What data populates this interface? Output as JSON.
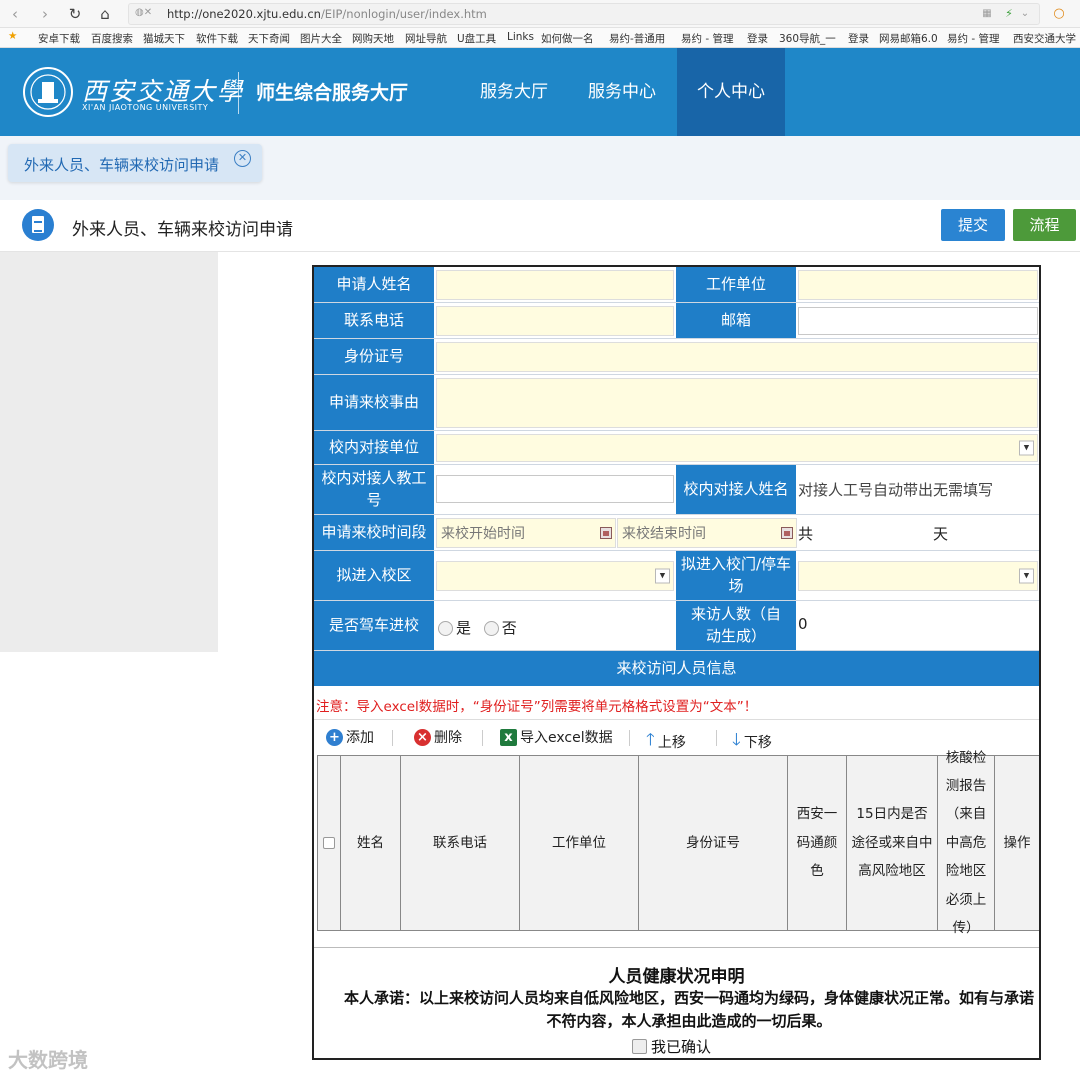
{
  "browser": {
    "url_prefix": "http://one2020.xjtu.edu.cn",
    "url_path": "/EIP/nonlogin/user/index.htm",
    "bookmarks": [
      "安卓下载",
      "百度搜索",
      "猫城天下",
      "软件下载",
      "天下奇闻",
      "图片大全",
      "网购天地",
      "网址导航",
      "U盘工具",
      "Links",
      "如何做一名",
      "易约-普通用",
      "易约 - 管理",
      "登录",
      "360导航_一",
      "登录",
      "网易邮箱6.0",
      "易约 - 管理",
      "西安交通大学"
    ]
  },
  "header": {
    "logo_cn": "西安交通大學",
    "logo_en": "XI'AN JIAOTONG UNIVERSITY",
    "hall_title": "师生综合服务大厅",
    "nav": [
      "服务大厅",
      "服务中心",
      "个人中心"
    ],
    "active_nav": "个人中心"
  },
  "tab": {
    "label": "外来人员、车辆来校访问申请",
    "close_symbol": "✕"
  },
  "page": {
    "title": "外来人员、车辆来校访问申请",
    "submit": "提交",
    "flow": "流程"
  },
  "form": {
    "applicant_name": "申请人姓名",
    "work_unit": "工作单位",
    "phone": "联系电话",
    "email": "邮箱",
    "id_number": "身份证号",
    "reason": "申请来校事由",
    "contact_dept": "校内对接单位",
    "contact_staff_no": "校内对接人教工号",
    "contact_name": "校内对接人姓名",
    "contact_name_hint": "对接人工号自动带出无需填写",
    "period": "申请来校时间段",
    "start_ph": "来校开始时间",
    "end_ph": "来校结束时间",
    "total_label": "共",
    "day_label": "天",
    "campus": "拟进入校区",
    "gate": "拟进入校门/停车场",
    "drive": "是否驾车进校",
    "yes": "是",
    "no": "否",
    "visitor_count": "来访人数（自动生成）",
    "visitor_count_value": "0"
  },
  "visitors": {
    "section_title": "来校访问人员信息",
    "notice": "注意：导入excel数据时，“身份证号”列需要将单元格格式设置为“文本”！",
    "toolbar": {
      "add": "添加",
      "delete": "删除",
      "import": "导入excel数据",
      "up": "上移",
      "down": "下移"
    },
    "columns": [
      "姓名",
      "联系电话",
      "工作单位",
      "身份证号",
      "西安一码通颜色",
      "15日内是否途径或来自中高风险地区",
      "核酸检测报告（来自中高危险地区必须上传）",
      "操作"
    ]
  },
  "health": {
    "title": "人员健康状况申明",
    "statement": "本人承诺：以上来校访问人员均来自低风险地区，西安一码通均为绿码，身体健康状况正常。如有与承诺不符内容，本人承担由此造成的一切后果。",
    "confirm": "我已确认"
  },
  "watermark": "大数跨境"
}
